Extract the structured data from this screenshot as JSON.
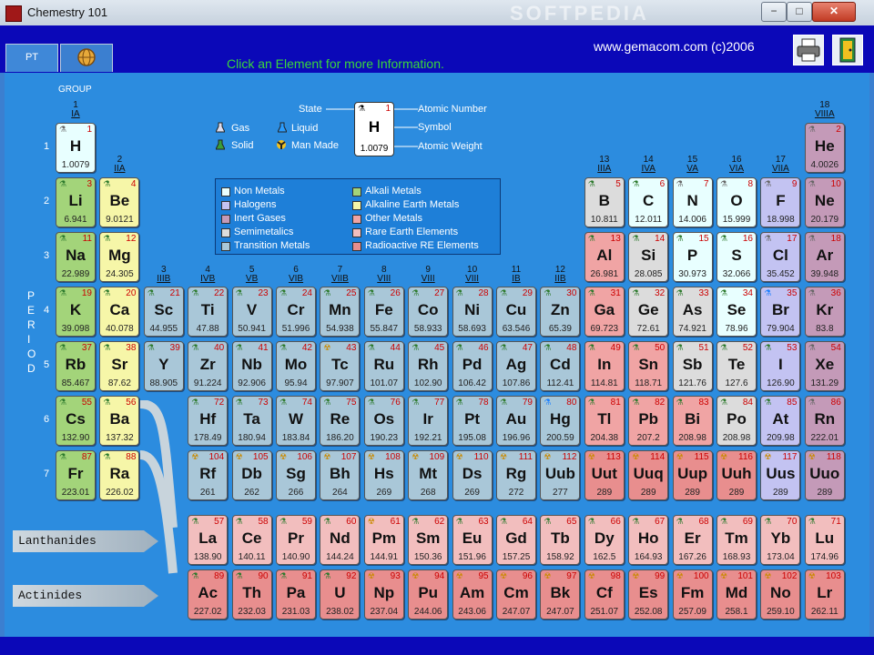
{
  "window": {
    "title": "Chemestry 101",
    "watermark": "SOFTPEDIA",
    "min": "−",
    "max": "□",
    "close": "✕"
  },
  "tabs": [
    {
      "label": "PT"
    },
    {
      "label": "",
      "icon": "globe-icon"
    }
  ],
  "header": {
    "message": "Click an Element for more Information.",
    "url": "www.gemacom.com  (c)2006",
    "print_icon": "printer-icon",
    "exit_icon": "exit-door-icon"
  },
  "labels": {
    "group": "GROUP",
    "period": "PERIOD",
    "lanthanides": "Lanthanides",
    "actinides": "Actinides"
  },
  "key": {
    "state": "State",
    "atomic_number": "Atomic Number",
    "symbol_label": "Symbol",
    "atomic_weight": "Atomic Weight",
    "num": "1",
    "sym": "H",
    "wt": "1.0079"
  },
  "states": {
    "gas": "Gas",
    "liquid": "Liquid",
    "solid": "Solid",
    "man_made": "Man Made"
  },
  "legend": [
    {
      "name": "Non Metals",
      "color": "#e8ffff"
    },
    {
      "name": "Alkali Metals",
      "color": "#a3d47a"
    },
    {
      "name": "Halogens",
      "color": "#c3c3f2"
    },
    {
      "name": "Alkaline Earth Metals",
      "color": "#f6f6a8"
    },
    {
      "name": "Inert Gases",
      "color": "#c49ab8"
    },
    {
      "name": "Other Metals",
      "color": "#f0a4a4"
    },
    {
      "name": "Semimetalics",
      "color": "#dcdcdc"
    },
    {
      "name": "Rare Earth Elements",
      "color": "#f2bebe"
    },
    {
      "name": "Transition Metals",
      "color": "#a9c7d8"
    },
    {
      "name": "Radioactive RE Elements",
      "color": "#e88e8e"
    }
  ],
  "group_labels": [
    {
      "num": "1",
      "roman": "IA"
    },
    {
      "num": "2",
      "roman": "IIA"
    },
    {
      "num": "3",
      "roman": "IIIB"
    },
    {
      "num": "4",
      "roman": "IVB"
    },
    {
      "num": "5",
      "roman": "VB"
    },
    {
      "num": "6",
      "roman": "VIB"
    },
    {
      "num": "7",
      "roman": "VIIB"
    },
    {
      "num": "8",
      "roman": "VIII"
    },
    {
      "num": "9",
      "roman": "VIII"
    },
    {
      "num": "10",
      "roman": "VIII"
    },
    {
      "num": "11",
      "roman": "IB"
    },
    {
      "num": "12",
      "roman": "IIB"
    },
    {
      "num": "13",
      "roman": "IIIA"
    },
    {
      "num": "14",
      "roman": "IVA"
    },
    {
      "num": "15",
      "roman": "VA"
    },
    {
      "num": "16",
      "roman": "VIA"
    },
    {
      "num": "17",
      "roman": "VIIA"
    },
    {
      "num": "18",
      "roman": "VIIIA"
    }
  ],
  "periods": [
    "1",
    "2",
    "3",
    "4",
    "5",
    "6",
    "7"
  ],
  "elements": [
    {
      "n": 1,
      "s": "H",
      "w": "1.0079",
      "c": "nonmetal",
      "st": "gas",
      "g": 1,
      "p": 1
    },
    {
      "n": 2,
      "s": "He",
      "w": "4.0026",
      "c": "inert",
      "st": "gas",
      "g": 18,
      "p": 1
    },
    {
      "n": 3,
      "s": "Li",
      "w": "6.941",
      "c": "alkali",
      "st": "solid",
      "g": 1,
      "p": 2
    },
    {
      "n": 4,
      "s": "Be",
      "w": "9.0121",
      "c": "alkaline",
      "st": "solid",
      "g": 2,
      "p": 2
    },
    {
      "n": 5,
      "s": "B",
      "w": "10.811",
      "c": "semi",
      "st": "solid",
      "g": 13,
      "p": 2
    },
    {
      "n": 6,
      "s": "C",
      "w": "12.011",
      "c": "nonmetal",
      "st": "solid",
      "g": 14,
      "p": 2
    },
    {
      "n": 7,
      "s": "N",
      "w": "14.006",
      "c": "nonmetal",
      "st": "gas",
      "g": 15,
      "p": 2
    },
    {
      "n": 8,
      "s": "O",
      "w": "15.999",
      "c": "nonmetal",
      "st": "gas",
      "g": 16,
      "p": 2
    },
    {
      "n": 9,
      "s": "F",
      "w": "18.998",
      "c": "halogen",
      "st": "gas",
      "g": 17,
      "p": 2
    },
    {
      "n": 10,
      "s": "Ne",
      "w": "20.179",
      "c": "inert",
      "st": "gas",
      "g": 18,
      "p": 2
    },
    {
      "n": 11,
      "s": "Na",
      "w": "22.989",
      "c": "alkali",
      "st": "solid",
      "g": 1,
      "p": 3
    },
    {
      "n": 12,
      "s": "Mg",
      "w": "24.305",
      "c": "alkaline",
      "st": "solid",
      "g": 2,
      "p": 3
    },
    {
      "n": 13,
      "s": "Al",
      "w": "26.981",
      "c": "other",
      "st": "solid",
      "g": 13,
      "p": 3
    },
    {
      "n": 14,
      "s": "Si",
      "w": "28.085",
      "c": "semi",
      "st": "solid",
      "g": 14,
      "p": 3
    },
    {
      "n": 15,
      "s": "P",
      "w": "30.973",
      "c": "nonmetal",
      "st": "solid",
      "g": 15,
      "p": 3
    },
    {
      "n": 16,
      "s": "S",
      "w": "32.066",
      "c": "nonmetal",
      "st": "solid",
      "g": 16,
      "p": 3
    },
    {
      "n": 17,
      "s": "Cl",
      "w": "35.452",
      "c": "halogen",
      "st": "gas",
      "g": 17,
      "p": 3
    },
    {
      "n": 18,
      "s": "Ar",
      "w": "39.948",
      "c": "inert",
      "st": "gas",
      "g": 18,
      "p": 3
    },
    {
      "n": 19,
      "s": "K",
      "w": "39.098",
      "c": "alkali",
      "st": "solid",
      "g": 1,
      "p": 4
    },
    {
      "n": 20,
      "s": "Ca",
      "w": "40.078",
      "c": "alkaline",
      "st": "solid",
      "g": 2,
      "p": 4
    },
    {
      "n": 21,
      "s": "Sc",
      "w": "44.955",
      "c": "transition",
      "st": "solid",
      "g": 3,
      "p": 4
    },
    {
      "n": 22,
      "s": "Ti",
      "w": "47.88",
      "c": "transition",
      "st": "solid",
      "g": 4,
      "p": 4
    },
    {
      "n": 23,
      "s": "V",
      "w": "50.941",
      "c": "transition",
      "st": "solid",
      "g": 5,
      "p": 4
    },
    {
      "n": 24,
      "s": "Cr",
      "w": "51.996",
      "c": "transition",
      "st": "solid",
      "g": 6,
      "p": 4
    },
    {
      "n": 25,
      "s": "Mn",
      "w": "54.938",
      "c": "transition",
      "st": "solid",
      "g": 7,
      "p": 4
    },
    {
      "n": 26,
      "s": "Fe",
      "w": "55.847",
      "c": "transition",
      "st": "solid",
      "g": 8,
      "p": 4
    },
    {
      "n": 27,
      "s": "Co",
      "w": "58.933",
      "c": "transition",
      "st": "solid",
      "g": 9,
      "p": 4
    },
    {
      "n": 28,
      "s": "Ni",
      "w": "58.693",
      "c": "transition",
      "st": "solid",
      "g": 10,
      "p": 4
    },
    {
      "n": 29,
      "s": "Cu",
      "w": "63.546",
      "c": "transition",
      "st": "solid",
      "g": 11,
      "p": 4
    },
    {
      "n": 30,
      "s": "Zn",
      "w": "65.39",
      "c": "transition",
      "st": "solid",
      "g": 12,
      "p": 4
    },
    {
      "n": 31,
      "s": "Ga",
      "w": "69.723",
      "c": "other",
      "st": "solid",
      "g": 13,
      "p": 4
    },
    {
      "n": 32,
      "s": "Ge",
      "w": "72.61",
      "c": "semi",
      "st": "solid",
      "g": 14,
      "p": 4
    },
    {
      "n": 33,
      "s": "As",
      "w": "74.921",
      "c": "semi",
      "st": "solid",
      "g": 15,
      "p": 4
    },
    {
      "n": 34,
      "s": "Se",
      "w": "78.96",
      "c": "nonmetal",
      "st": "solid",
      "g": 16,
      "p": 4
    },
    {
      "n": 35,
      "s": "Br",
      "w": "79.904",
      "c": "halogen",
      "st": "liquid",
      "g": 17,
      "p": 4
    },
    {
      "n": 36,
      "s": "Kr",
      "w": "83.8",
      "c": "inert",
      "st": "gas",
      "g": 18,
      "p": 4
    },
    {
      "n": 37,
      "s": "Rb",
      "w": "85.467",
      "c": "alkali",
      "st": "solid",
      "g": 1,
      "p": 5
    },
    {
      "n": 38,
      "s": "Sr",
      "w": "87.62",
      "c": "alkaline",
      "st": "solid",
      "g": 2,
      "p": 5
    },
    {
      "n": 39,
      "s": "Y",
      "w": "88.905",
      "c": "transition",
      "st": "solid",
      "g": 3,
      "p": 5
    },
    {
      "n": 40,
      "s": "Zr",
      "w": "91.224",
      "c": "transition",
      "st": "solid",
      "g": 4,
      "p": 5
    },
    {
      "n": 41,
      "s": "Nb",
      "w": "92.906",
      "c": "transition",
      "st": "solid",
      "g": 5,
      "p": 5
    },
    {
      "n": 42,
      "s": "Mo",
      "w": "95.94",
      "c": "transition",
      "st": "solid",
      "g": 6,
      "p": 5
    },
    {
      "n": 43,
      "s": "Tc",
      "w": "97.907",
      "c": "transition",
      "st": "manmade",
      "g": 7,
      "p": 5
    },
    {
      "n": 44,
      "s": "Ru",
      "w": "101.07",
      "c": "transition",
      "st": "solid",
      "g": 8,
      "p": 5
    },
    {
      "n": 45,
      "s": "Rh",
      "w": "102.90",
      "c": "transition",
      "st": "solid",
      "g": 9,
      "p": 5
    },
    {
      "n": 46,
      "s": "Pd",
      "w": "106.42",
      "c": "transition",
      "st": "solid",
      "g": 10,
      "p": 5
    },
    {
      "n": 47,
      "s": "Ag",
      "w": "107.86",
      "c": "transition",
      "st": "solid",
      "g": 11,
      "p": 5
    },
    {
      "n": 48,
      "s": "Cd",
      "w": "112.41",
      "c": "transition",
      "st": "solid",
      "g": 12,
      "p": 5
    },
    {
      "n": 49,
      "s": "In",
      "w": "114.81",
      "c": "other",
      "st": "solid",
      "g": 13,
      "p": 5
    },
    {
      "n": 50,
      "s": "Sn",
      "w": "118.71",
      "c": "other",
      "st": "solid",
      "g": 14,
      "p": 5
    },
    {
      "n": 51,
      "s": "Sb",
      "w": "121.76",
      "c": "semi",
      "st": "solid",
      "g": 15,
      "p": 5
    },
    {
      "n": 52,
      "s": "Te",
      "w": "127.6",
      "c": "semi",
      "st": "solid",
      "g": 16,
      "p": 5
    },
    {
      "n": 53,
      "s": "I",
      "w": "126.90",
      "c": "halogen",
      "st": "solid",
      "g": 17,
      "p": 5
    },
    {
      "n": 54,
      "s": "Xe",
      "w": "131.29",
      "c": "inert",
      "st": "gas",
      "g": 18,
      "p": 5
    },
    {
      "n": 55,
      "s": "Cs",
      "w": "132.90",
      "c": "alkali",
      "st": "solid",
      "g": 1,
      "p": 6
    },
    {
      "n": 56,
      "s": "Ba",
      "w": "137.32",
      "c": "alkaline",
      "st": "solid",
      "g": 2,
      "p": 6
    },
    {
      "n": 72,
      "s": "Hf",
      "w": "178.49",
      "c": "transition",
      "st": "solid",
      "g": 4,
      "p": 6
    },
    {
      "n": 73,
      "s": "Ta",
      "w": "180.94",
      "c": "transition",
      "st": "solid",
      "g": 5,
      "p": 6
    },
    {
      "n": 74,
      "s": "W",
      "w": "183.84",
      "c": "transition",
      "st": "solid",
      "g": 6,
      "p": 6
    },
    {
      "n": 75,
      "s": "Re",
      "w": "186.20",
      "c": "transition",
      "st": "solid",
      "g": 7,
      "p": 6
    },
    {
      "n": 76,
      "s": "Os",
      "w": "190.23",
      "c": "transition",
      "st": "solid",
      "g": 8,
      "p": 6
    },
    {
      "n": 77,
      "s": "Ir",
      "w": "192.21",
      "c": "transition",
      "st": "solid",
      "g": 9,
      "p": 6
    },
    {
      "n": 78,
      "s": "Pt",
      "w": "195.08",
      "c": "transition",
      "st": "solid",
      "g": 10,
      "p": 6
    },
    {
      "n": 79,
      "s": "Au",
      "w": "196.96",
      "c": "transition",
      "st": "solid",
      "g": 11,
      "p": 6
    },
    {
      "n": 80,
      "s": "Hg",
      "w": "200.59",
      "c": "transition",
      "st": "liquid",
      "g": 12,
      "p": 6
    },
    {
      "n": 81,
      "s": "Tl",
      "w": "204.38",
      "c": "other",
      "st": "solid",
      "g": 13,
      "p": 6
    },
    {
      "n": 82,
      "s": "Pb",
      "w": "207.2",
      "c": "other",
      "st": "solid",
      "g": 14,
      "p": 6
    },
    {
      "n": 83,
      "s": "Bi",
      "w": "208.98",
      "c": "other",
      "st": "solid",
      "g": 15,
      "p": 6
    },
    {
      "n": 84,
      "s": "Po",
      "w": "208.98",
      "c": "semi",
      "st": "solid",
      "g": 16,
      "p": 6
    },
    {
      "n": 85,
      "s": "At",
      "w": "209.98",
      "c": "halogen",
      "st": "solid",
      "g": 17,
      "p": 6
    },
    {
      "n": 86,
      "s": "Rn",
      "w": "222.01",
      "c": "inert",
      "st": "gas",
      "g": 18,
      "p": 6
    },
    {
      "n": 87,
      "s": "Fr",
      "w": "223.01",
      "c": "alkali",
      "st": "solid",
      "g": 1,
      "p": 7
    },
    {
      "n": 88,
      "s": "Ra",
      "w": "226.02",
      "c": "alkaline",
      "st": "solid",
      "g": 2,
      "p": 7
    },
    {
      "n": 104,
      "s": "Rf",
      "w": "261",
      "c": "transition",
      "st": "manmade",
      "g": 4,
      "p": 7
    },
    {
      "n": 105,
      "s": "Db",
      "w": "262",
      "c": "transition",
      "st": "manmade",
      "g": 5,
      "p": 7
    },
    {
      "n": 106,
      "s": "Sg",
      "w": "266",
      "c": "transition",
      "st": "manmade",
      "g": 6,
      "p": 7
    },
    {
      "n": 107,
      "s": "Bh",
      "w": "264",
      "c": "transition",
      "st": "manmade",
      "g": 7,
      "p": 7
    },
    {
      "n": 108,
      "s": "Hs",
      "w": "269",
      "c": "transition",
      "st": "manmade",
      "g": 8,
      "p": 7
    },
    {
      "n": 109,
      "s": "Mt",
      "w": "268",
      "c": "transition",
      "st": "manmade",
      "g": 9,
      "p": 7
    },
    {
      "n": 110,
      "s": "Ds",
      "w": "269",
      "c": "transition",
      "st": "manmade",
      "g": 10,
      "p": 7
    },
    {
      "n": 111,
      "s": "Rg",
      "w": "272",
      "c": "transition",
      "st": "manmade",
      "g": 11,
      "p": 7
    },
    {
      "n": 112,
      "s": "Uub",
      "w": "277",
      "c": "transition",
      "st": "manmade",
      "g": 12,
      "p": 7
    },
    {
      "n": 113,
      "s": "Uut",
      "w": "289",
      "c": "radio",
      "st": "manmade",
      "g": 13,
      "p": 7
    },
    {
      "n": 114,
      "s": "Uuq",
      "w": "289",
      "c": "radio",
      "st": "manmade",
      "g": 14,
      "p": 7
    },
    {
      "n": 115,
      "s": "Uup",
      "w": "289",
      "c": "radio",
      "st": "manmade",
      "g": 15,
      "p": 7
    },
    {
      "n": 116,
      "s": "Uuh",
      "w": "289",
      "c": "radio",
      "st": "manmade",
      "g": 16,
      "p": 7
    },
    {
      "n": 117,
      "s": "Uus",
      "w": "289",
      "c": "halogen",
      "st": "manmade",
      "g": 17,
      "p": 7
    },
    {
      "n": 118,
      "s": "Uuo",
      "w": "289",
      "c": "inert",
      "st": "manmade",
      "g": 18,
      "p": 7
    },
    {
      "n": 57,
      "s": "La",
      "w": "138.90",
      "c": "rare",
      "st": "solid",
      "g": 4,
      "p": 8
    },
    {
      "n": 58,
      "s": "Ce",
      "w": "140.11",
      "c": "rare",
      "st": "solid",
      "g": 5,
      "p": 8
    },
    {
      "n": 59,
      "s": "Pr",
      "w": "140.90",
      "c": "rare",
      "st": "solid",
      "g": 6,
      "p": 8
    },
    {
      "n": 60,
      "s": "Nd",
      "w": "144.24",
      "c": "rare",
      "st": "solid",
      "g": 7,
      "p": 8
    },
    {
      "n": 61,
      "s": "Pm",
      "w": "144.91",
      "c": "rare",
      "st": "manmade",
      "g": 8,
      "p": 8
    },
    {
      "n": 62,
      "s": "Sm",
      "w": "150.36",
      "c": "rare",
      "st": "solid",
      "g": 9,
      "p": 8
    },
    {
      "n": 63,
      "s": "Eu",
      "w": "151.96",
      "c": "rare",
      "st": "solid",
      "g": 10,
      "p": 8
    },
    {
      "n": 64,
      "s": "Gd",
      "w": "157.25",
      "c": "rare",
      "st": "solid",
      "g": 11,
      "p": 8
    },
    {
      "n": 65,
      "s": "Tb",
      "w": "158.92",
      "c": "rare",
      "st": "solid",
      "g": 12,
      "p": 8
    },
    {
      "n": 66,
      "s": "Dy",
      "w": "162.5",
      "c": "rare",
      "st": "solid",
      "g": 13,
      "p": 8
    },
    {
      "n": 67,
      "s": "Ho",
      "w": "164.93",
      "c": "rare",
      "st": "solid",
      "g": 14,
      "p": 8
    },
    {
      "n": 68,
      "s": "Er",
      "w": "167.26",
      "c": "rare",
      "st": "solid",
      "g": 15,
      "p": 8
    },
    {
      "n": 69,
      "s": "Tm",
      "w": "168.93",
      "c": "rare",
      "st": "solid",
      "g": 16,
      "p": 8
    },
    {
      "n": 70,
      "s": "Yb",
      "w": "173.04",
      "c": "rare",
      "st": "solid",
      "g": 17,
      "p": 8
    },
    {
      "n": 71,
      "s": "Lu",
      "w": "174.96",
      "c": "rare",
      "st": "solid",
      "g": 18,
      "p": 8
    },
    {
      "n": 89,
      "s": "Ac",
      "w": "227.02",
      "c": "radio",
      "st": "solid",
      "g": 4,
      "p": 9
    },
    {
      "n": 90,
      "s": "Th",
      "w": "232.03",
      "c": "radio",
      "st": "solid",
      "g": 5,
      "p": 9
    },
    {
      "n": 91,
      "s": "Pa",
      "w": "231.03",
      "c": "radio",
      "st": "solid",
      "g": 6,
      "p": 9
    },
    {
      "n": 92,
      "s": "U",
      "w": "238.02",
      "c": "radio",
      "st": "solid",
      "g": 7,
      "p": 9
    },
    {
      "n": 93,
      "s": "Np",
      "w": "237.04",
      "c": "radio",
      "st": "manmade",
      "g": 8,
      "p": 9
    },
    {
      "n": 94,
      "s": "Pu",
      "w": "244.06",
      "c": "radio",
      "st": "manmade",
      "g": 9,
      "p": 9
    },
    {
      "n": 95,
      "s": "Am",
      "w": "243.06",
      "c": "radio",
      "st": "manmade",
      "g": 10,
      "p": 9
    },
    {
      "n": 96,
      "s": "Cm",
      "w": "247.07",
      "c": "radio",
      "st": "manmade",
      "g": 11,
      "p": 9
    },
    {
      "n": 97,
      "s": "Bk",
      "w": "247.07",
      "c": "radio",
      "st": "manmade",
      "g": 12,
      "p": 9
    },
    {
      "n": 98,
      "s": "Cf",
      "w": "251.07",
      "c": "radio",
      "st": "manmade",
      "g": 13,
      "p": 9
    },
    {
      "n": 99,
      "s": "Es",
      "w": "252.08",
      "c": "radio",
      "st": "manmade",
      "g": 14,
      "p": 9
    },
    {
      "n": 100,
      "s": "Fm",
      "w": "257.09",
      "c": "radio",
      "st": "manmade",
      "g": 15,
      "p": 9
    },
    {
      "n": 101,
      "s": "Md",
      "w": "258.1",
      "c": "radio",
      "st": "manmade",
      "g": 16,
      "p": 9
    },
    {
      "n": 102,
      "s": "No",
      "w": "259.10",
      "c": "radio",
      "st": "manmade",
      "g": 17,
      "p": 9
    },
    {
      "n": 103,
      "s": "Lr",
      "w": "262.11",
      "c": "radio",
      "st": "manmade",
      "g": 18,
      "p": 9
    }
  ],
  "category_colors": {
    "nonmetal": "#e8ffff",
    "alkali": "#a3d47a",
    "alkaline": "#f6f6a8",
    "halogen": "#c3c3f2",
    "inert": "#c49ab8",
    "other": "#f0a4a4",
    "semi": "#dcdcdc",
    "rare": "#f2bebe",
    "transition": "#a9c7d8",
    "radio": "#e88e8e"
  },
  "state_icons": {
    "gas": "flask-icon",
    "liquid": "flask-icon",
    "solid": "flask-icon",
    "manmade": "radiation-icon"
  }
}
